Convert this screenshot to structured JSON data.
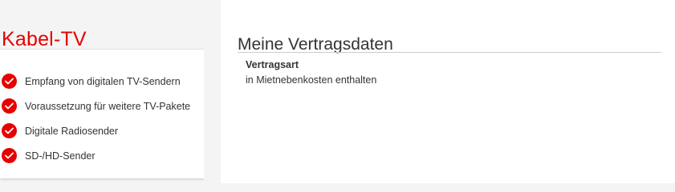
{
  "product_card": {
    "title": "Kabel-TV",
    "features": [
      {
        "label": "Empfang von digitalen TV-Sendern",
        "icon": "check-circle-icon"
      },
      {
        "label": "Voraussetzung für weitere TV-Pakete",
        "icon": "check-circle-icon"
      },
      {
        "label": "Digitale Radiosender",
        "icon": "check-circle-icon"
      },
      {
        "label": "SD-/HD-Sender",
        "icon": "check-circle-icon"
      }
    ]
  },
  "contract": {
    "title": "Meine Vertragsdaten",
    "field_label": "Vertragsart",
    "field_value": "in Mietnebenkosten enthalten"
  },
  "colors": {
    "brand_red": "#e60000",
    "background": "#f4f4f4",
    "text": "#333333"
  }
}
